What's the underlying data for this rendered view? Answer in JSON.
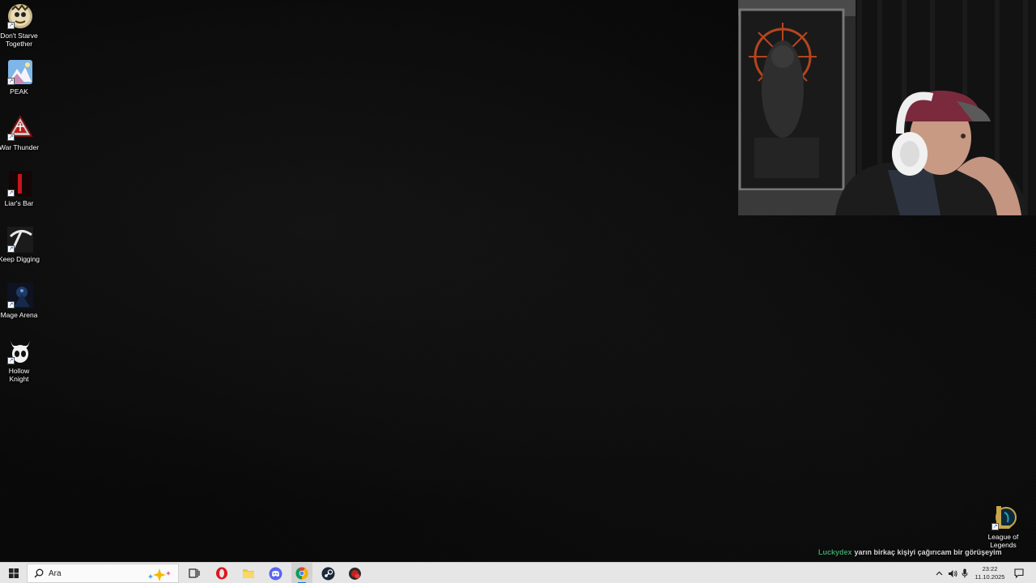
{
  "desktop": {
    "icons": [
      {
        "label": "Don't Starve\nTogether",
        "icon": "dont-starve-icon"
      },
      {
        "label": "PEAK",
        "icon": "peak-icon"
      },
      {
        "label": "War Thunder",
        "icon": "war-thunder-icon"
      },
      {
        "label": "Liar's Bar",
        "icon": "liars-bar-icon"
      },
      {
        "label": "Keep Digging",
        "icon": "pickaxe-icon"
      },
      {
        "label": "Mage Arena",
        "icon": "mage-arena-icon"
      },
      {
        "label": "Hollow\nKnight",
        "icon": "hollow-knight-icon"
      }
    ],
    "league_icon": {
      "label": "League of\nLegends",
      "icon": "league-of-legends-icon"
    }
  },
  "chat": {
    "user": "Luckydex",
    "message": "yarın birkaç kişiyi çağırıcam bir görüşeyim",
    "user_color": "#3fa36b"
  },
  "taskbar": {
    "search_placeholder": "Ara",
    "apps": [
      "task-view-icon",
      "opera-icon",
      "file-explorer-icon",
      "discord-icon",
      "chrome-icon",
      "steam-icon",
      "app-icon"
    ],
    "time": "23:22",
    "date": "11.10.2025"
  }
}
